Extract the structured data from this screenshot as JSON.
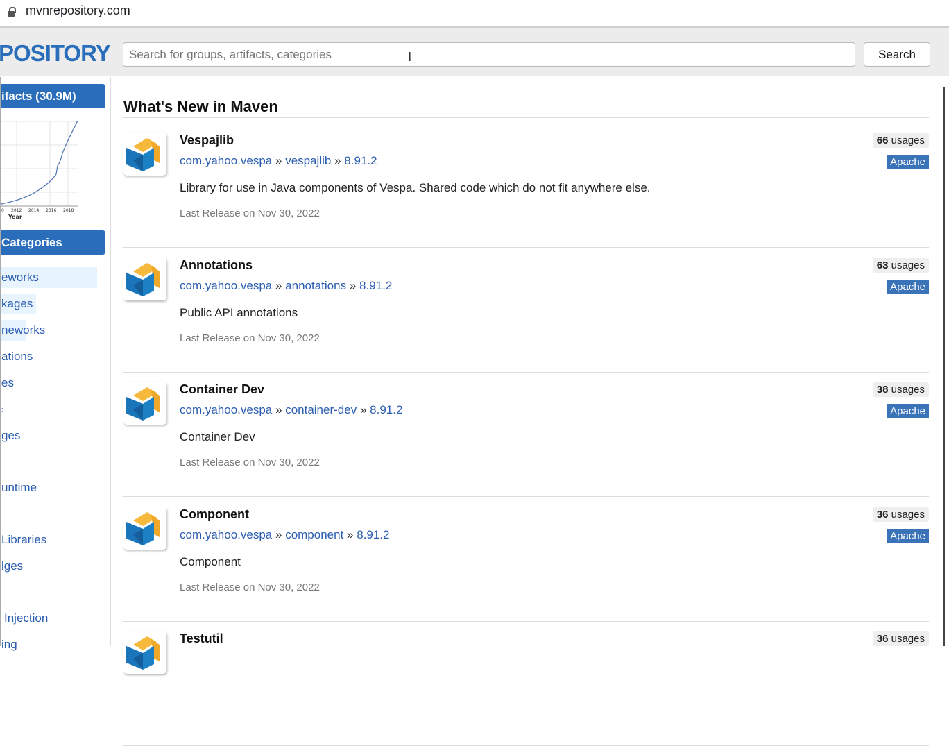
{
  "browser": {
    "url": "mvnrepository.com"
  },
  "header": {
    "logo": "POSITORY",
    "search_placeholder": "Search for groups, artifacts, categories",
    "search_button": "Search"
  },
  "sidebar": {
    "artifacts_label": "ifacts (30.9M)",
    "chart": {
      "x_ticks": [
        "0",
        "2012",
        "2014",
        "2016",
        "2018"
      ],
      "xlabel": "Year"
    },
    "categories_label": "Categories",
    "categories": [
      "eworks",
      "kages",
      "neworks",
      "ations",
      "es",
      ":",
      "ges",
      "",
      "untime",
      "",
      "Libraries",
      "lges",
      "",
      "Injection",
      "ing"
    ]
  },
  "main": {
    "title": "What's New in Maven",
    "items": [
      {
        "name": "Vespajlib",
        "group": "com.yahoo.vespa",
        "artifact": "vespajlib",
        "version": "8.91.2",
        "desc": "Library for use in Java components of Vespa. Shared code which do not fit anywhere else.",
        "release": "Last Release on Nov 30, 2022",
        "usages": "66",
        "usages_label": "usages",
        "license": "Apache"
      },
      {
        "name": "Annotations",
        "group": "com.yahoo.vespa",
        "artifact": "annotations",
        "version": "8.91.2",
        "desc": "Public API annotations",
        "release": "Last Release on Nov 30, 2022",
        "usages": "63",
        "usages_label": "usages",
        "license": "Apache"
      },
      {
        "name": "Container Dev",
        "group": "com.yahoo.vespa",
        "artifact": "container-dev",
        "version": "8.91.2",
        "desc": "Container Dev",
        "release": "Last Release on Nov 30, 2022",
        "usages": "38",
        "usages_label": "usages",
        "license": "Apache"
      },
      {
        "name": "Component",
        "group": "com.yahoo.vespa",
        "artifact": "component",
        "version": "8.91.2",
        "desc": "Component",
        "release": "Last Release on Nov 30, 2022",
        "usages": "36",
        "usages_label": "usages",
        "license": "Apache"
      },
      {
        "name": "Testutil",
        "usages": "36",
        "usages_label": "usages"
      }
    ]
  },
  "colors": {
    "brand": "#2a6ebb",
    "link": "#2a5db0",
    "license": "#3b73b9"
  }
}
